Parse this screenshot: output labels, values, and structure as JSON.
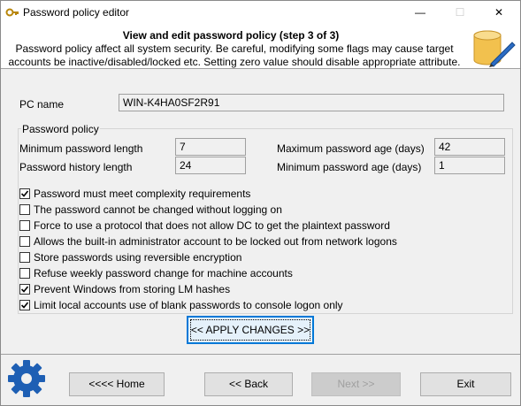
{
  "window": {
    "title": "Password policy editor",
    "minimize_glyph": "—",
    "maximize_glyph": "☐",
    "close_glyph": "✕"
  },
  "header": {
    "title": "View and edit password policy (step 3 of 3)",
    "description": "Password policy affect all system security. Be careful, modifying some flags may cause target accounts be inactive/disabled/locked etc. Setting zero value should disable appropriate attribute.",
    "icon": "database-edit-icon"
  },
  "pc": {
    "label": "PC name",
    "value": "WIN-K4HA0SF2R91"
  },
  "policy": {
    "group_title": "Password policy",
    "min_length_label": "Minimum password length",
    "min_length_value": "7",
    "history_label": "Password history length",
    "history_value": "24",
    "max_age_label": "Maximum password age (days)",
    "max_age_value": "42",
    "min_age_label": "Minimum password age (days)",
    "min_age_value": "1"
  },
  "checkboxes": [
    {
      "label": "Password must meet complexity requirements",
      "checked": true
    },
    {
      "label": "The password cannot be changed without logging on",
      "checked": false
    },
    {
      "label": "Force to use a protocol that does not allow DC to get the plaintext password",
      "checked": false
    },
    {
      "label": "Allows the built-in administrator account to be locked out from network logons",
      "checked": false
    },
    {
      "label": "Store passwords using reversible encryption",
      "checked": false
    },
    {
      "label": "Refuse weekly password change for machine accounts",
      "checked": false
    },
    {
      "label": "Prevent Windows from storing LM hashes",
      "checked": true
    },
    {
      "label": "Limit local accounts use of blank passwords to console logon only",
      "checked": true
    }
  ],
  "buttons": {
    "apply": "<< APPLY CHANGES >>",
    "home": "<<<< Home",
    "back": "<< Back",
    "next": "Next >>",
    "exit": "Exit"
  },
  "colors": {
    "accent": "#0078d7",
    "window_bg": "#f0f0f0",
    "gear": "#1e5fb4",
    "database": "#f2c14e"
  }
}
